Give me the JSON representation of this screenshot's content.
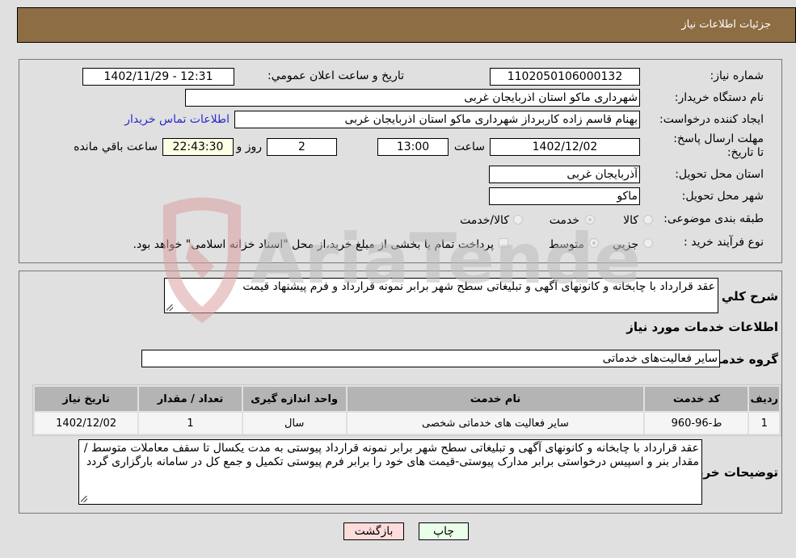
{
  "header": {
    "title": "جزئیات اطلاعات نیاز"
  },
  "fields": {
    "need_number_label": "شماره نیاز:",
    "need_number": "1102050106000132",
    "announce_label": "تاریخ و ساعت اعلان عمومي:",
    "announce_value": "1402/11/29 - 12:31",
    "buyer_org_label": "نام دستگاه خريدار:",
    "buyer_org": "شهرداری ماکو استان اذربایجان غربی",
    "creator_label": "ايجاد کننده درخواست:",
    "creator": "بهنام قاسم زاده کاربرداز شهرداری ماکو استان اذربایجان غربی",
    "contact_link": "اطلاعات تماس خريدار",
    "deadline_label": "مهلت ارسال پاسخ: تا تاریخ:",
    "deadline_date": "1402/12/02",
    "time_label": "ساعت",
    "deadline_time": "13:00",
    "days_value": "2",
    "days_label": "روز و",
    "remaining_time": "22:43:30",
    "remaining_label": "ساعت باقي مانده",
    "province_label": "استان محل تحويل:",
    "province": "آذربایجان غربی",
    "city_label": "شهر محل تحويل:",
    "city": "ماکو",
    "category_label": "طبقه بندی موضوعی:",
    "category_options": [
      {
        "label": "کالا",
        "checked": false
      },
      {
        "label": "خدمت",
        "checked": true
      },
      {
        "label": "کالا/خدمت",
        "checked": false
      }
    ],
    "process_label": "نوع فرآيند خريد :",
    "process_options": [
      {
        "label": "جزيي",
        "checked": false
      },
      {
        "label": "متوسط",
        "checked": true
      }
    ],
    "treasury_note": "پرداخت تمام يا بخشی از مبلغ خريد،از محل \"اسناد خزانه اسلامی\" خواهد بود."
  },
  "details": {
    "description_label": "شرح کلي نياز:",
    "description": "عقد قرارداد با چابخانه و کانونهای آگهی و تبلیغاتی سطح شهر برابر نمونه قرارداد و فرم پیشنهاد قیمت",
    "services_title": "اطلاعات خدمات مورد نياز",
    "service_group_label": "گروه خدمت:",
    "service_group": "سایر فعالیت‌های خدماتی",
    "table": {
      "headers": [
        "رديف",
        "کد خدمت",
        "نام خدمت",
        "واحد اندازه گيری",
        "تعداد / مقدار",
        "تاريخ نياز"
      ],
      "rows": [
        [
          "1",
          "ط-96-960",
          "سایر فعالیت های خدماتی شخصی",
          "سال",
          "1",
          "1402/12/02"
        ]
      ]
    },
    "buyer_notes_label": "توضيحات خريدار:",
    "buyer_notes": "عقد قرارداد با چابخانه و کانونهای آگهی و تبلیغاتی سطح شهر برابر نمونه قرارداد پیوستی به مدت یکسال تا سقف معاملات متوسط /مقدار بنر و اسپیس درخواستی برابر مدارک پیوستی-قیمت های خود را برابر فرم پیوستی تکمیل و جمع کل در سامانه بارگزاری گردد"
  },
  "buttons": {
    "print": "چاپ",
    "back": "بازگشت"
  },
  "watermark": {
    "text": "AriaTender.neT"
  },
  "colors": {
    "header_bg": "#8d6d43",
    "print_bg": "#eaffea",
    "back_bg": "#ffdcdc",
    "link": "#2a2ad0"
  }
}
